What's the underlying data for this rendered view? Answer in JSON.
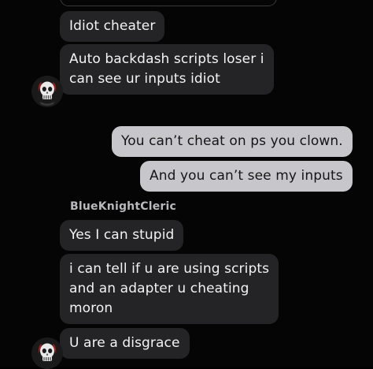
{
  "colors": {
    "background": "#050505",
    "incoming_bubble": "#242427",
    "outgoing_bubble": "#c7c7cb",
    "incoming_text": "#f3f3f3",
    "outgoing_text": "#151515",
    "sender_name": "#b9b9bd"
  },
  "messages": {
    "m1": {
      "text": "Idiot cheater"
    },
    "m2": {
      "lines": [
        "Auto backdash scripts loser i",
        "can see ur inputs idiot"
      ]
    },
    "m3": {
      "text": "You can’t cheat on ps you clown."
    },
    "m4": {
      "text": "And you can’t see my inputs"
    },
    "sender_name": "BlueKnightCleric",
    "m5": {
      "text": "Yes I can stupid"
    },
    "m6": {
      "lines": [
        "i can tell if u are using scripts",
        "and an adapter u cheating",
        "moron"
      ]
    },
    "m7": {
      "text": "U are a disgrace"
    }
  },
  "avatar": {
    "icon": "skull-avatar-icon"
  }
}
